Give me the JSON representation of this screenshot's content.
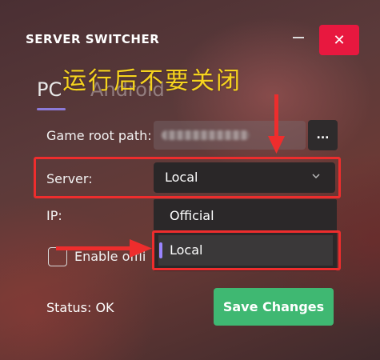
{
  "window": {
    "title": "SERVER SWITCHER",
    "minimize_glyph": "—",
    "close_glyph": "✕"
  },
  "annotation": {
    "top_text": "运行后不要关闭",
    "color": "#f6d31e",
    "arrow_color": "#ee2d2d"
  },
  "tabs": [
    {
      "label": "PC",
      "active": true
    },
    {
      "label": "Android",
      "active": false
    }
  ],
  "form": {
    "game_root_path_label": "Game root path:",
    "browse_label": "...",
    "server_label": "Server:",
    "server_selected": "Local",
    "server_options": [
      "Official",
      "Local"
    ],
    "ip_label": "IP:",
    "offline_label": "Enable offli",
    "offline_checked": false
  },
  "footer": {
    "status_text": "Status: OK",
    "save_label": "Save Changes"
  },
  "colors": {
    "accent": "#8c7ad8",
    "close_red": "#e8183f",
    "save_green": "#3fb872",
    "highlight_red": "#ee2d2d"
  },
  "icons": {
    "minimize": "minimize-icon",
    "close": "close-icon",
    "dropdown": "chevron-down-icon",
    "selected_marker": "selection-marker"
  }
}
